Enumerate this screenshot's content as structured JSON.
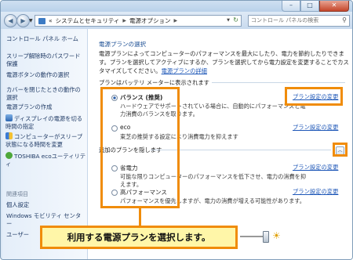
{
  "window": {
    "minimize_glyph": "–",
    "maximize_glyph": "□",
    "close_glyph": "✕"
  },
  "nav": {
    "back_glyph": "◀",
    "forward_glyph": "▶",
    "breadcrumb_prefix": "«",
    "breadcrumb": [
      "システムとセキュリティ",
      "電源オプション"
    ],
    "search_placeholder": "コントロール パネルの検索"
  },
  "sidebar": {
    "home": "コントロール パネル ホーム",
    "links": [
      "スリープ解除時のパスワード保護",
      "電源ボタンの動作の選択",
      "カバーを閉じたときの動作の選択",
      "電源プランの作成",
      "ディスプレイの電源を切る時間の指定",
      "コンピューターがスリープ状態になる時間を変更",
      "TOSHIBA ecoユーティリティ"
    ],
    "related_header": "関連項目",
    "related_links": [
      "個人設定",
      "Windows モビリティ センター",
      "ユーザー"
    ]
  },
  "main": {
    "title": "電源プランの選択",
    "description": "電源プランによってコンピューターのパフォーマンスを最大にしたり、電力を節約したりできます。プランを選択してアクティブにするか、プランを選択してから電力設定を変更することでカスタマイズしてください。",
    "description_link": "電源プランの詳細",
    "group_battery": "プランはバッテリ メーターに表示されます",
    "group_additional": "追加のプランを隠します",
    "change_link": "プラン設定の変更",
    "plans": [
      {
        "name": "バランス (推奨)",
        "desc": "ハードウェアでサポートされている場合に、自動的にパフォーマンスと電力消費のバランスを取ります。",
        "selected": true
      },
      {
        "name": "eco",
        "desc": "東芝の推奨する設定により消費電力を抑えます",
        "selected": false
      },
      {
        "name": "省電力",
        "desc": "可能な限りコンピューターのパフォーマンスを低下させ、電力の消費を抑えます。",
        "selected": false
      },
      {
        "name": "高パフォーマンス",
        "desc": "パフォーマンスを優先しますが、電力の消費が増える可能性があります。",
        "selected": false
      }
    ],
    "collapse_glyph": "︿"
  },
  "annotation": {
    "callout_text": "利用する電源プランを選択します。",
    "accent_color": "#f08c0a"
  }
}
